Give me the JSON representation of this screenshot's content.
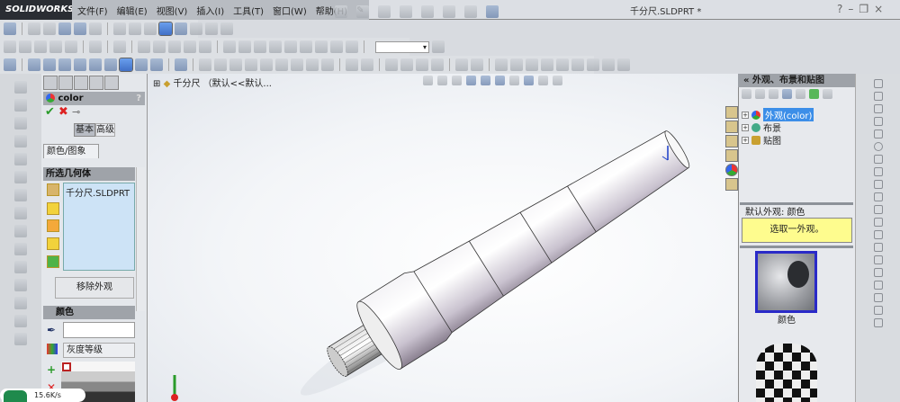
{
  "app": {
    "logo": "SOLIDWORKS",
    "document_title": "千分尺.SLDPRT *"
  },
  "menu": [
    "文件(F)",
    "编辑(E)",
    "视图(V)",
    "插入(I)",
    "工具(T)",
    "窗口(W)",
    "帮助(H)"
  ],
  "property_manager": {
    "title": "color",
    "help": "?",
    "mode_buttons": {
      "basic": "基本",
      "advanced": "高级"
    },
    "tab": "颜色/图象",
    "selected_geometry": {
      "header": "所选几何体",
      "items": [
        "千分尺.SLDPRT"
      ],
      "remove_button": "移除外观"
    },
    "color": {
      "header": "颜色",
      "value": "",
      "palette": "灰度等级"
    }
  },
  "feature_tree": {
    "root": "千分尺 （默认<<默认..."
  },
  "task_pane": {
    "title": "外观、布景和贴图",
    "tree": [
      "外观(color)",
      "布景",
      "贴图"
    ],
    "default_label": "默认外观: 颜色",
    "hint": "选取一外观。",
    "thumbnail_label": "颜色"
  },
  "status": {
    "speed": "15.6K/s"
  },
  "colors": {
    "selection": "#3c8ee8",
    "hint_bg": "#fefc8e",
    "thumb_border": "#2a2ac8"
  }
}
